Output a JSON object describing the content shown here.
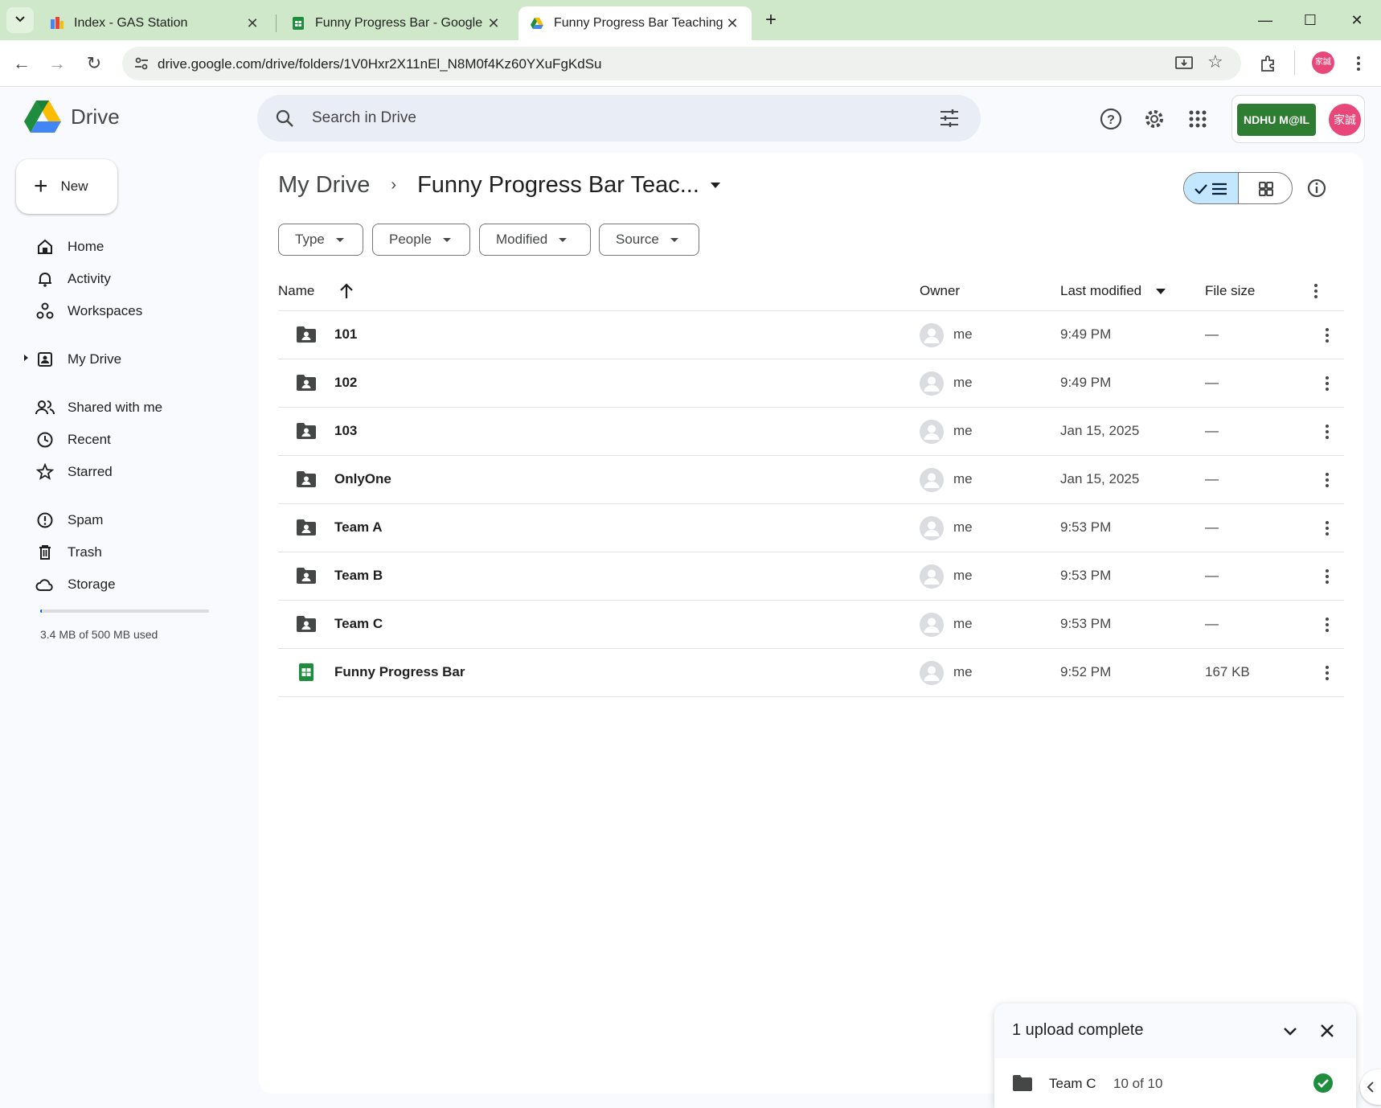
{
  "browser": {
    "tabs": [
      {
        "title": "Index - GAS Station"
      },
      {
        "title": "Funny Progress Bar - Google Sheets"
      },
      {
        "title": "Funny Progress Bar Teaching - Google Drive"
      }
    ],
    "url": "drive.google.com/drive/folders/1V0Hxr2X11nEl_N8M0f4Kz60YXuFgKdSu",
    "profile_avatar_text": "家誠"
  },
  "drive": {
    "logo_text": "Drive",
    "search_placeholder": "Search in Drive",
    "account_badge": "NDHU M@IL",
    "account_avatar_text": "家誠"
  },
  "sidebar": {
    "new_label": "New",
    "items": [
      {
        "label": "Home",
        "icon": "home-icon"
      },
      {
        "label": "Activity",
        "icon": "bell-icon"
      },
      {
        "label": "Workspaces",
        "icon": "workspaces-icon"
      },
      {
        "label": "My Drive",
        "icon": "my-drive-icon"
      },
      {
        "label": "Shared with me",
        "icon": "people-icon"
      },
      {
        "label": "Recent",
        "icon": "clock-icon"
      },
      {
        "label": "Starred",
        "icon": "star-icon"
      },
      {
        "label": "Spam",
        "icon": "spam-icon"
      },
      {
        "label": "Trash",
        "icon": "trash-icon"
      },
      {
        "label": "Storage",
        "icon": "cloud-icon"
      }
    ],
    "storage_text": "3.4 MB of 500 MB used",
    "storage_fraction": 0.0068
  },
  "breadcrumb": {
    "root": "My Drive",
    "current": "Funny Progress Bar Teac..."
  },
  "filters": [
    {
      "label": "Type"
    },
    {
      "label": "People"
    },
    {
      "label": "Modified"
    },
    {
      "label": "Source"
    }
  ],
  "columns": {
    "name": "Name",
    "owner": "Owner",
    "modified": "Last modified",
    "size": "File size"
  },
  "files": [
    {
      "name": "101",
      "type": "shared-folder",
      "owner": "me",
      "modified": "9:49 PM",
      "size": "—"
    },
    {
      "name": "102",
      "type": "shared-folder",
      "owner": "me",
      "modified": "9:49 PM",
      "size": "—"
    },
    {
      "name": "103",
      "type": "shared-folder",
      "owner": "me",
      "modified": "Jan 15, 2025",
      "size": "—"
    },
    {
      "name": "OnlyOne",
      "type": "shared-folder",
      "owner": "me",
      "modified": "Jan 15, 2025",
      "size": "—"
    },
    {
      "name": "Team A",
      "type": "shared-folder",
      "owner": "me",
      "modified": "9:53 PM",
      "size": "—"
    },
    {
      "name": "Team B",
      "type": "shared-folder",
      "owner": "me",
      "modified": "9:53 PM",
      "size": "—"
    },
    {
      "name": "Team C",
      "type": "shared-folder",
      "owner": "me",
      "modified": "9:53 PM",
      "size": "—"
    },
    {
      "name": "Funny Progress Bar",
      "type": "spreadsheet",
      "owner": "me",
      "modified": "9:52 PM",
      "size": "167 KB"
    }
  ],
  "upload": {
    "title": "1 upload complete",
    "item_name": "Team C",
    "item_progress": "10 of 10"
  },
  "colors": {
    "tabstrip": "#cfe8c9",
    "accent": "#0b57d0",
    "selected_toggle": "#c2e7ff",
    "sheets_green": "#1e8e3e",
    "success_green": "#1e8e3e"
  }
}
